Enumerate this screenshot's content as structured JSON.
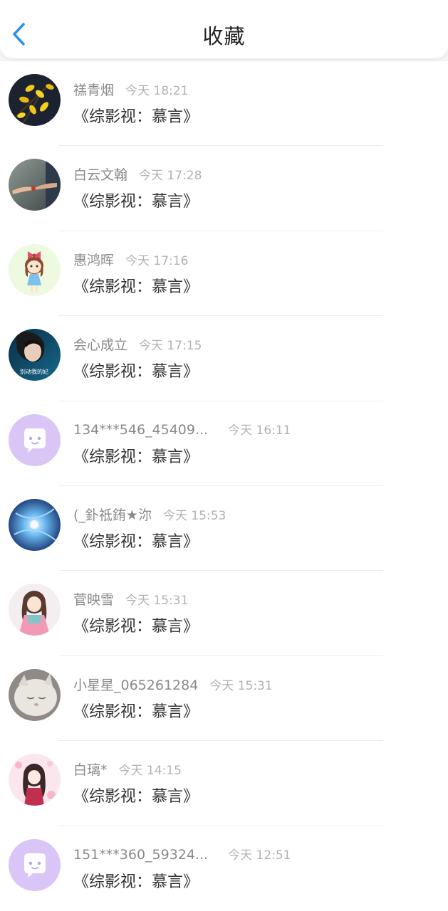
{
  "header": {
    "title": "收藏"
  },
  "colors": {
    "accent": "#2b8ff0",
    "default_avatar_bg": "#d9c6f7",
    "default_avatar_icon": "#ffffff"
  },
  "items": [
    {
      "name": "禚青烟",
      "time": "今天 18:21",
      "book": "《综影视：慕言》",
      "avatar": "yellow-flowers-avatar"
    },
    {
      "name": "白云文翰",
      "time": "今天 17:28",
      "book": "《综影视：慕言》",
      "avatar": "hands-photo-avatar"
    },
    {
      "name": "惠鸿晖",
      "time": "今天 17:16",
      "book": "《综影视：慕言》",
      "avatar": "cartoon-girl-avatar"
    },
    {
      "name": "会心成立",
      "time": "今天 17:15",
      "book": "《综影视：慕言》",
      "avatar": "portrait-photo-avatar",
      "avatar_caption": "别动我的妃"
    },
    {
      "name": "134***546_45409...",
      "time": "今天 16:11",
      "book": "《综影视：慕言》",
      "avatar": "default-chat-avatar"
    },
    {
      "name": "(_釙祗銪★沵",
      "time": "今天 15:53",
      "book": "《综影视：慕言》",
      "avatar": "blue-abstract-avatar"
    },
    {
      "name": "菅映雪",
      "time": "今天 15:31",
      "book": "《综影视：慕言》",
      "avatar": "anime-girl-avatar"
    },
    {
      "name": "小星星_065261284",
      "time": "今天 15:31",
      "book": "《综影视：慕言》",
      "avatar": "cat-photo-avatar"
    },
    {
      "name": "白璃*",
      "time": "今天 14:15",
      "book": "《综影视：慕言》",
      "avatar": "anime-pink-avatar"
    },
    {
      "name": "151***360_59324...",
      "time": "今天 12:51",
      "book": "《综影视：慕言》",
      "avatar": "default-chat-avatar"
    }
  ]
}
